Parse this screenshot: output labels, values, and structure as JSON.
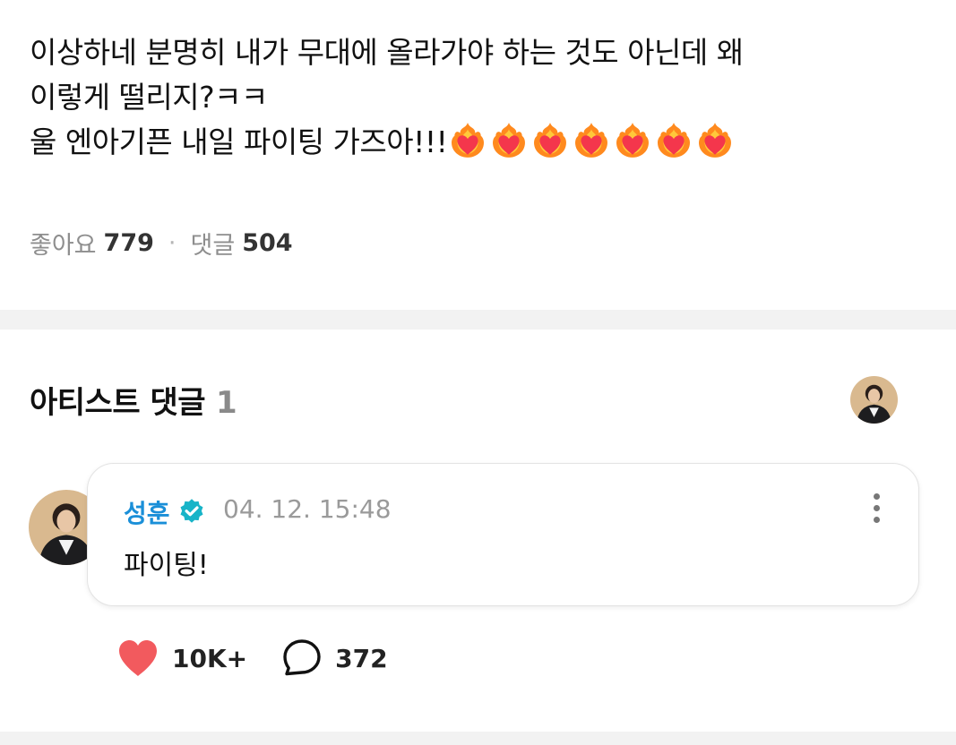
{
  "post": {
    "lines": [
      "이상하네 분명히 내가 무대에 올라가야 하는 것도 아닌데 왜",
      "이렇게 떨리지?ㅋㅋ",
      "울 엔아기픈 내일 파이팅 가즈아!!!"
    ],
    "emoji_icon": "heart-on-fire",
    "emoji_count": 7,
    "likes_label": "좋아요",
    "likes_count": "779",
    "comments_label": "댓글",
    "comments_count": "504"
  },
  "artist_section": {
    "title": "아티스트 댓글",
    "count": "1"
  },
  "comment": {
    "author": "성훈",
    "verified_icon": "verified-badge-icon",
    "timestamp": "04. 12. 15:48",
    "text": "파이팅!",
    "likes": "10K+",
    "replies": "372"
  },
  "colors": {
    "author": "#1a8fd8",
    "verified": "#18b4c8",
    "heart": "#f25a5e",
    "divider": "#f2f2f2"
  }
}
